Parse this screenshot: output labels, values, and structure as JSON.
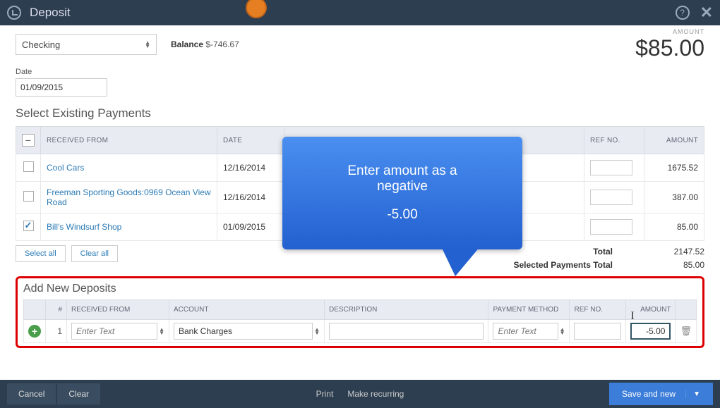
{
  "header": {
    "title": "Deposit"
  },
  "account": {
    "selected": "Checking",
    "balance_label": "Balance",
    "balance_value": "$-746.67"
  },
  "amount": {
    "label": "AMOUNT",
    "value": "$85.00"
  },
  "date": {
    "label": "Date",
    "value": "01/09/2015"
  },
  "existing": {
    "title": "Select Existing Payments",
    "columns": {
      "received_from": "RECEIVED FROM",
      "date": "DATE",
      "ref_no": "REF NO.",
      "amount": "AMOUNT"
    },
    "rows": [
      {
        "checked": false,
        "received_from": "Cool Cars",
        "date": "12/16/2014",
        "amount": "1675.52"
      },
      {
        "checked": false,
        "received_from": "Freeman Sporting Goods:0969 Ocean View Road",
        "date": "12/16/2014",
        "amount": "387.00"
      },
      {
        "checked": true,
        "received_from": "Bill's Windsurf Shop",
        "date": "01/09/2015",
        "amount": "85.00"
      }
    ],
    "select_all": "Select all",
    "clear_all": "Clear all",
    "total_label": "Total",
    "total_value": "2147.52",
    "selected_label": "Selected Payments Total",
    "selected_value": "85.00"
  },
  "new_deposits": {
    "title": "Add New Deposits",
    "columns": {
      "num": "#",
      "received_from": "RECEIVED FROM",
      "account": "ACCOUNT",
      "description": "DESCRIPTION",
      "payment_method": "PAYMENT METHOD",
      "ref_no": "REF NO.",
      "amount": "AMOUNT"
    },
    "row": {
      "num": "1",
      "received_from_placeholder": "Enter Text",
      "account": "Bank Charges",
      "payment_method_placeholder": "Enter Text",
      "amount": "-5.00"
    }
  },
  "footer": {
    "cancel": "Cancel",
    "clear": "Clear",
    "print": "Print",
    "make_recurring": "Make recurring",
    "save": "Save and new"
  },
  "callout": {
    "line1": "Enter amount as a",
    "line2": "negative",
    "line3": "-5.00"
  }
}
